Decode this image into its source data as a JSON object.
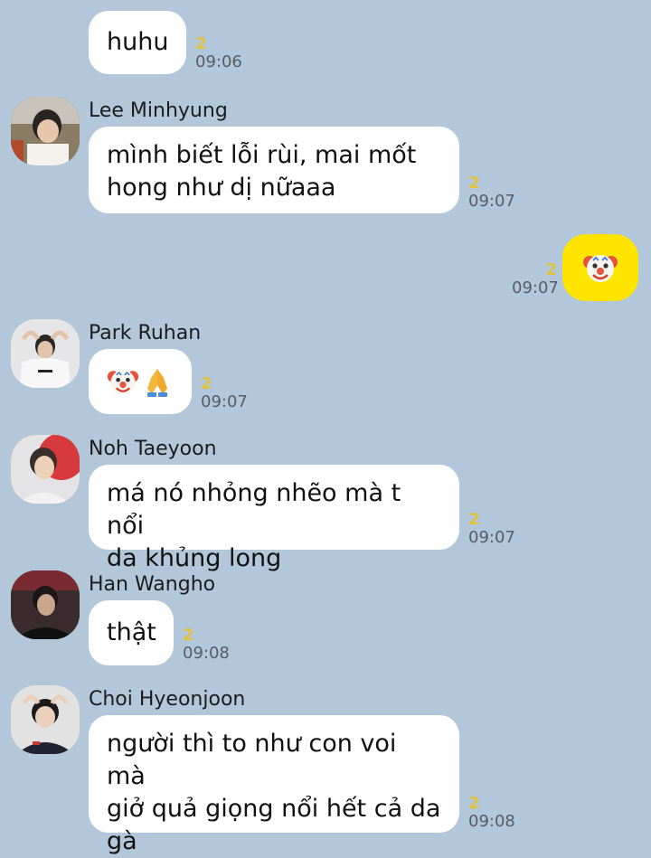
{
  "messages": [
    {
      "sender": "",
      "text": "huhu",
      "unread": "2",
      "time": "09:06"
    },
    {
      "sender": "Lee Minhyung",
      "line1": "mình biết lỗi rùi, mai mốt",
      "line2": "hong như dị nữaaa",
      "unread": "2",
      "time": "09:07"
    },
    {
      "sender": "me",
      "emoji": "clown-face",
      "unread": "2",
      "time": "09:07"
    },
    {
      "sender": "Park Ruhan",
      "emojis": [
        "clown-face",
        "folded-hands"
      ],
      "unread": "2",
      "time": "09:07"
    },
    {
      "sender": "Noh Taeyoon",
      "line1": "má nó nhỏng nhẽo mà t nổi",
      "line2": "da khủng long",
      "unread": "2",
      "time": "09:07"
    },
    {
      "sender": "Han Wangho",
      "text": "thật",
      "unread": "2",
      "time": "09:08"
    },
    {
      "sender": "Choi Hyeonjoon",
      "line1": "người thì to như con voi mà",
      "line2": "giở quả giọng nổi hết cả da",
      "line3": "gà",
      "unread": "2",
      "time": "09:08"
    }
  ],
  "colors": {
    "background": "#b2c7da",
    "incoming_bubble": "#ffffff",
    "outgoing_bubble": "#fee500",
    "unread_count": "#e0c23a"
  }
}
